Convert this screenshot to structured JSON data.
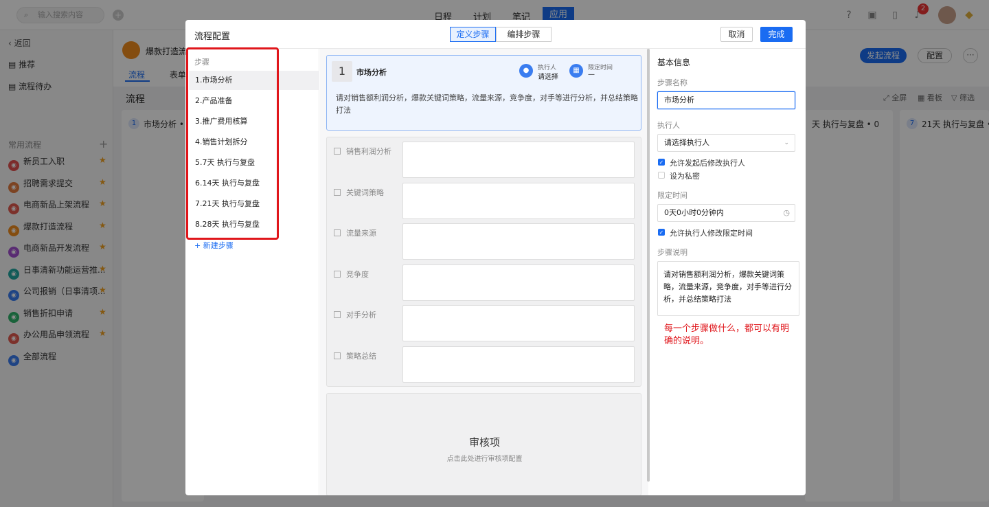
{
  "topbar": {
    "search_placeholder": "输入搜索内容",
    "tabs": [
      "日程",
      "计划",
      "笔记",
      "应用"
    ],
    "notification_count": "2"
  },
  "sidebar": {
    "back": "返回",
    "items_top": [
      "推荐",
      "流程待办"
    ],
    "common_header": "常用流程",
    "items": [
      {
        "label": "新员工入职",
        "color": "#e2504f"
      },
      {
        "label": "招聘需求提交",
        "color": "#e27b3f"
      },
      {
        "label": "电商新品上架流程",
        "color": "#e25a4f"
      },
      {
        "label": "爆款打造流程",
        "color": "#f08c1e"
      },
      {
        "label": "电商新品开发流程",
        "color": "#a24fcf"
      },
      {
        "label": "日事清新功能运营推...",
        "color": "#1fa7a0"
      },
      {
        "label": "公司报销（日事清项...",
        "color": "#3a7df0"
      },
      {
        "label": "销售折扣申请",
        "color": "#2fb36b"
      },
      {
        "label": "办公用品申领流程",
        "color": "#e25a4f"
      },
      {
        "label": "全部流程",
        "color": "#3a7df0"
      }
    ]
  },
  "main": {
    "title": "爆款打造流程",
    "tabs": [
      "流程",
      "表单"
    ],
    "section_title": "流程",
    "start_button": "发起流程",
    "config_button": "配置",
    "toolbar": [
      "全屏",
      "看板",
      "筛选"
    ],
    "step_cards": [
      "市场分析 •",
      "天 执行与复盘 • 0",
      "21天 执行与复盘 •"
    ],
    "step_card_nums": [
      "1",
      "7"
    ]
  },
  "modal": {
    "title": "流程配置",
    "seg_define": "定义步骤",
    "seg_arrange": "编排步骤",
    "cancel": "取消",
    "done": "完成",
    "steps_header": "步骤",
    "steps": [
      "1.市场分析",
      "2.产品准备",
      "3.推广费用核算",
      "4.销售计划拆分",
      "5.7天 执行与复盘",
      "6.14天 执行与复盘",
      "7.21天 执行与复盘",
      "8.28天 执行与复盘"
    ],
    "new_step": "+ 新建步骤",
    "card": {
      "num": "1",
      "title": "市场分析",
      "executor_label": "执行人",
      "executor_value": "请选择",
      "time_label": "限定时间",
      "time_value": "—",
      "desc": "请对销售额利润分析，爆款关键词策略，流量来源，竞争度，对手等进行分析，并总结策略打法"
    },
    "fields": [
      "销售利润分析",
      "关键词策略",
      "流量来源",
      "竞争度",
      "对手分析",
      "策略总结"
    ],
    "audit_title": "审核项",
    "audit_sub": "点击此处进行审核项配置",
    "right": {
      "header": "基本信息",
      "name_label": "步骤名称",
      "name_value": "市场分析",
      "executor_label": "执行人",
      "executor_value": "请选择执行人",
      "chk1": "允许发起后修改执行人",
      "chk2": "设为私密",
      "time_label": "限定时间",
      "time_value": "0天0小时0分钟内",
      "chk3": "允许执行人修改限定时间",
      "desc_label": "步骤说明",
      "desc_value": "请对销售额利润分析，爆款关键词策略，流量来源，竞争度，对手等进行分析，并总结策略打法",
      "note": "每一个步骤做什么，都可以有明确的说明。"
    }
  }
}
